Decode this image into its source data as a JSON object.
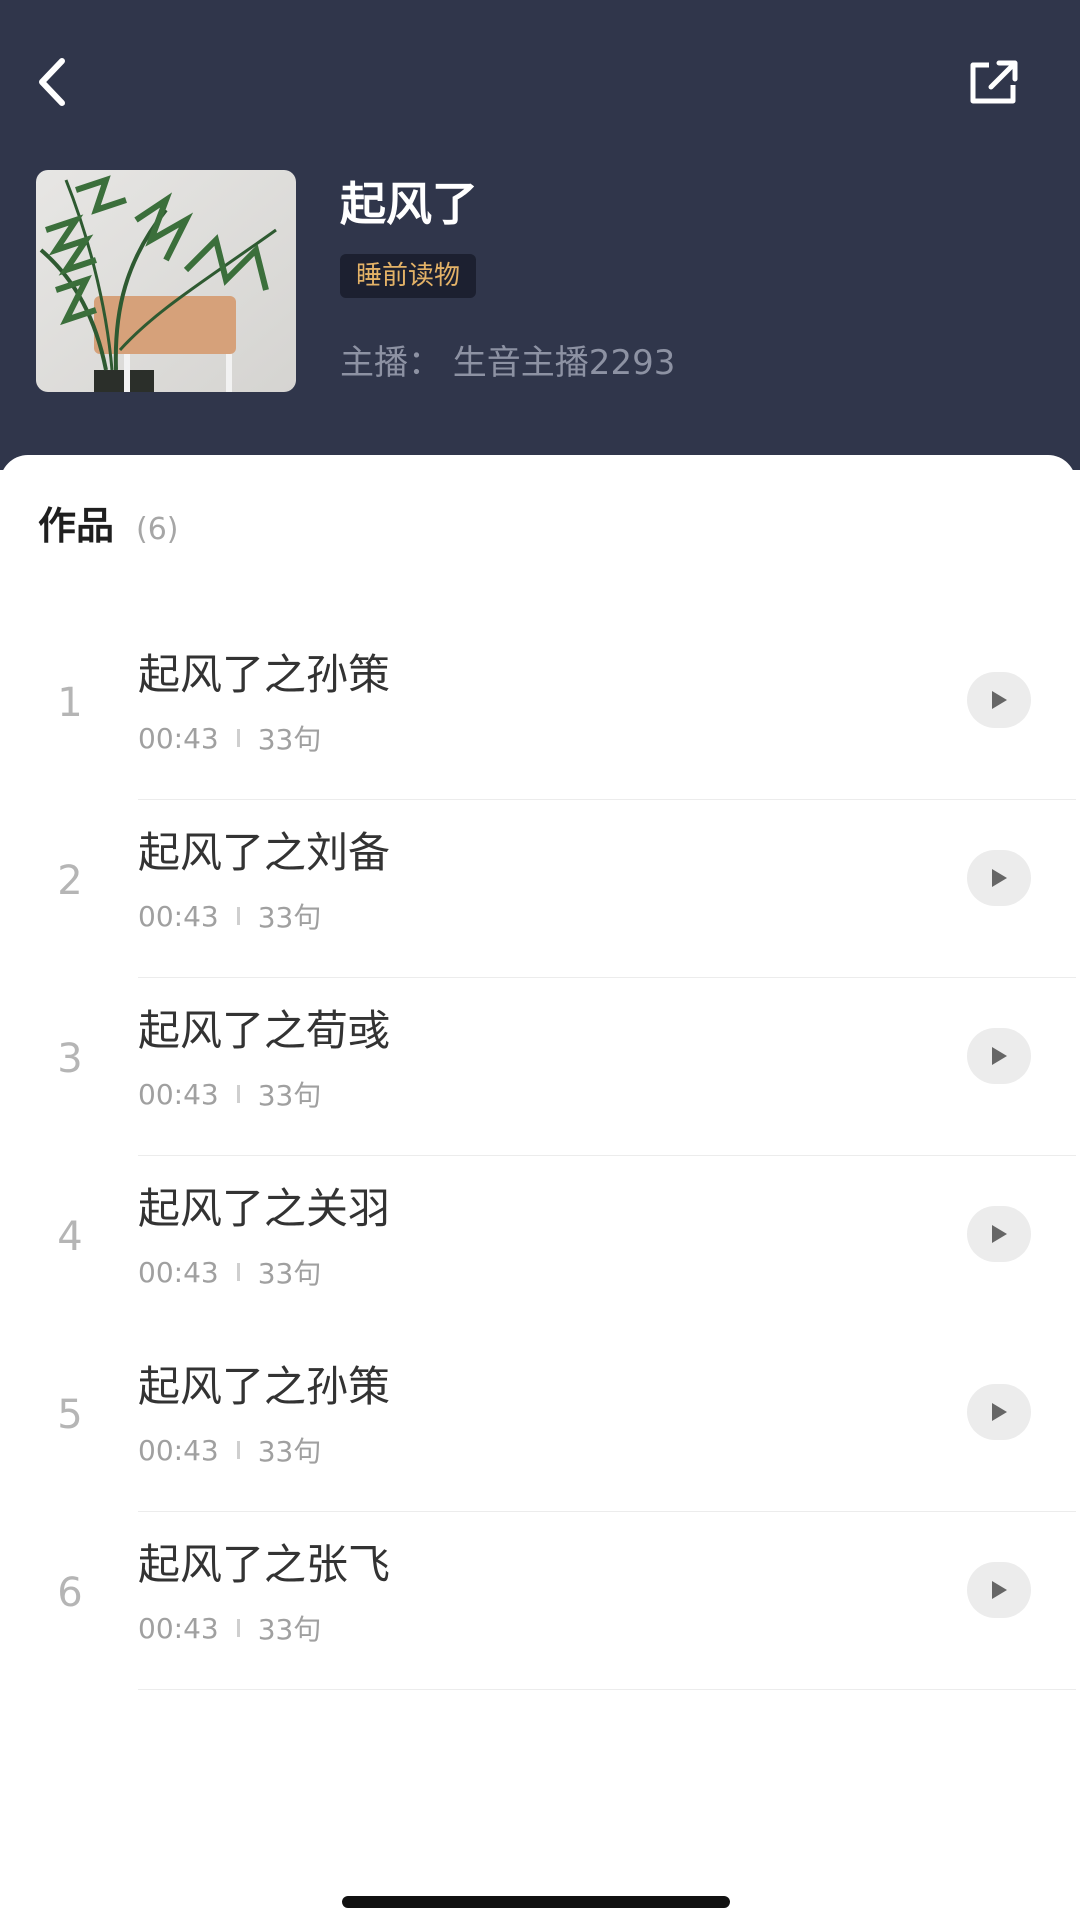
{
  "header": {
    "back_icon": "chevron-left-icon",
    "share_icon": "share-external-icon",
    "album_title": "起风了",
    "category_tag": "睡前读物",
    "host_line": "主播：  生音主播2293",
    "background_color": "#30364b",
    "tag_color": "#e3b267"
  },
  "works": {
    "title": "作品",
    "count": "(6)",
    "tracks": [
      {
        "index": "1",
        "title": "起风了之孙策",
        "duration": "00:43",
        "sentences": "33句"
      },
      {
        "index": "2",
        "title": "起风了之刘备",
        "duration": "00:43",
        "sentences": "33句"
      },
      {
        "index": "3",
        "title": "起风了之荀彧",
        "duration": "00:43",
        "sentences": "33句"
      },
      {
        "index": "4",
        "title": "起风了之关羽",
        "duration": "00:43",
        "sentences": "33句"
      },
      {
        "index": "5",
        "title": "起风了之孙策",
        "duration": "00:43",
        "sentences": "33句"
      },
      {
        "index": "6",
        "title": "起风了之张飞",
        "duration": "00:43",
        "sentences": "33句"
      }
    ],
    "play_icon": "play-icon"
  }
}
